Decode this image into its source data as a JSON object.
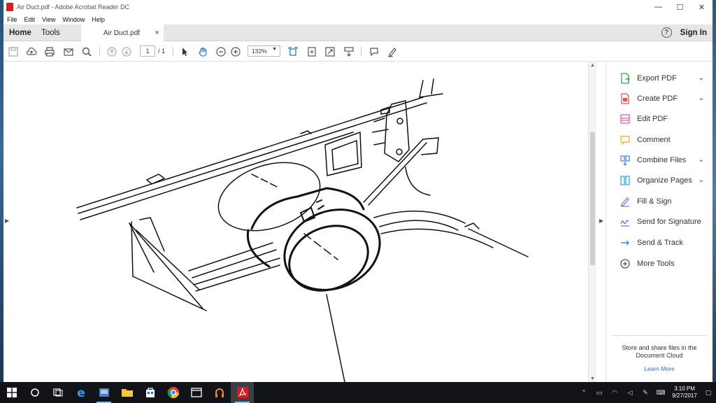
{
  "window": {
    "title": "Air Duct.pdf - Adobe Acrobat Reader DC",
    "minimize": "—",
    "maximize": "☐",
    "close": "✕"
  },
  "menu": [
    "File",
    "Edit",
    "View",
    "Window",
    "Help"
  ],
  "tabs": {
    "home": "Home",
    "tools": "Tools",
    "document": "Air Duct.pdf",
    "close": "×"
  },
  "header": {
    "help": "?",
    "sign_in": "Sign In"
  },
  "toolbar": {
    "page_current": "1",
    "page_total": "/ 1",
    "zoom": "132%",
    "zoom_dropdown": "▼"
  },
  "tools_pane": {
    "items": [
      {
        "label": "Export PDF",
        "icon": "export-pdf-icon",
        "color": "#2ea84a",
        "expandable": true
      },
      {
        "label": "Create PDF",
        "icon": "create-pdf-icon",
        "color": "#e2574c",
        "expandable": true
      },
      {
        "label": "Edit PDF",
        "icon": "edit-pdf-icon",
        "color": "#e35ea6",
        "expandable": false
      },
      {
        "label": "Comment",
        "icon": "comment-icon",
        "color": "#f2b632",
        "expandable": false
      },
      {
        "label": "Combine Files",
        "icon": "combine-files-icon",
        "color": "#3d8be0",
        "expandable": true
      },
      {
        "label": "Organize Pages",
        "icon": "organize-pages-icon",
        "color": "#3aa8d8",
        "expandable": true
      },
      {
        "label": "Fill & Sign",
        "icon": "fill-sign-icon",
        "color": "#8a6fd1",
        "expandable": false
      },
      {
        "label": "Send for Signature",
        "icon": "send-signature-icon",
        "color": "#6b6fd6",
        "expandable": false
      },
      {
        "label": "Send & Track",
        "icon": "send-track-icon",
        "color": "#3d8be0",
        "expandable": false
      },
      {
        "label": "More Tools",
        "icon": "more-tools-icon",
        "color": "#555555",
        "expandable": false
      }
    ],
    "chevron": "⌄",
    "cloud_message": "Store and share files in the Document Cloud",
    "learn_more": "Learn More"
  },
  "taskbar": {
    "time": "3:10 PM",
    "date": "9/27/2017"
  },
  "colors": {
    "accent": "#2a6ebb",
    "acrobat_red": "#d11f1f",
    "taskbar": "#101418"
  }
}
